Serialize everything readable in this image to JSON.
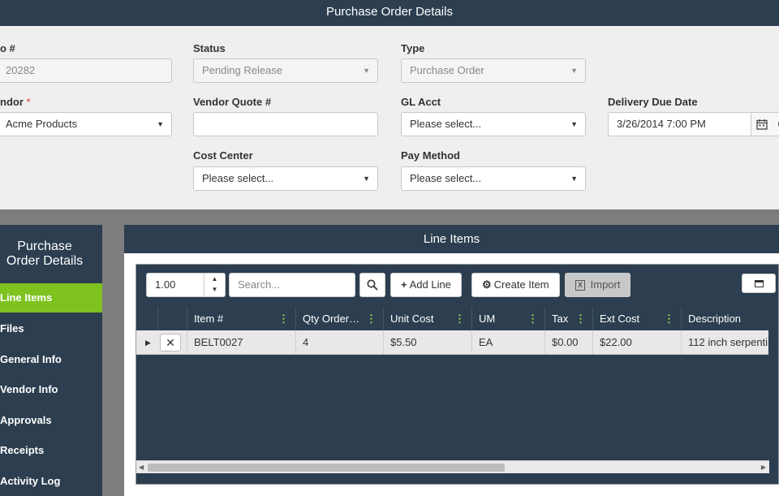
{
  "window": {
    "title": "Purchase Order Details"
  },
  "form": {
    "po_label": "o #",
    "po_value": "20282",
    "status_label": "Status",
    "status_value": "Pending Release",
    "type_label": "Type",
    "type_value": "Purchase Order",
    "vendor_label": "ndor",
    "vendor_required": "*",
    "vendor_value": "Acme Products",
    "vendor_quote_label": "Vendor Quote #",
    "vendor_quote_value": "",
    "gl_acct_label": "GL Acct",
    "gl_acct_placeholder": "Please select...",
    "delivery_label": "Delivery Due Date",
    "delivery_value": "3/26/2014 7:00 PM",
    "cost_center_label": "Cost Center",
    "cost_center_placeholder": "Please select...",
    "pay_method_label": "Pay Method",
    "pay_method_placeholder": "Please select..."
  },
  "sidebar": {
    "title": "Purchase Order Details",
    "items": [
      {
        "label": "Line Items",
        "active": true
      },
      {
        "label": "Files"
      },
      {
        "label": "General Info"
      },
      {
        "label": "Vendor Info"
      },
      {
        "label": "Approvals"
      },
      {
        "label": "Receipts"
      },
      {
        "label": "Activity Log"
      }
    ]
  },
  "line_items": {
    "title": "Line Items",
    "toolbar": {
      "quantity": "1.00",
      "search_placeholder": "Search...",
      "add_line_label": "Add Line",
      "create_item_label": "Create Item",
      "import_label": "Import"
    },
    "columns": [
      "Item #",
      "Qty Order…",
      "Unit Cost",
      "UM",
      "Tax",
      "Ext Cost",
      "Description"
    ],
    "rows": [
      {
        "item": "BELT0027",
        "qty": "4",
        "unit_cost": "$5.50",
        "um": "EA",
        "tax": "$0.00",
        "ext_cost": "$22.00",
        "description": "112 inch serpentin"
      }
    ]
  },
  "icons": {
    "dropdown": "caret-down-icon",
    "calendar": "calendar-icon",
    "clock": "clock-icon",
    "search": "search-icon",
    "add": "plus-icon",
    "settings": "gear-icon",
    "import": "excel-icon",
    "delete": "close-icon",
    "expand": "caret-right-icon",
    "maximize": "window-icon"
  },
  "colors": {
    "header": "#2c3e50",
    "accent": "#7dc21e",
    "required": "#e33333"
  }
}
